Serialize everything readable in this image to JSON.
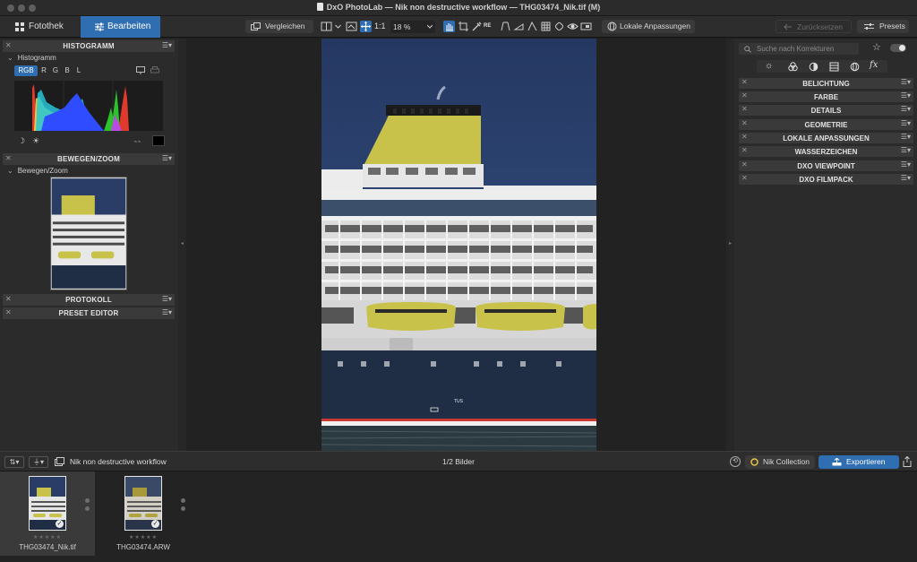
{
  "window": {
    "title": "DxO PhotoLab — Nik non destructive workflow — THG03474_Nik.tif (M)"
  },
  "toolbar": {
    "tab_library": "Fotothek",
    "tab_edit": "Bearbeiten",
    "compare_label": "Vergleichen",
    "one_to_one": "1:1",
    "zoom_value": "18 %",
    "local_adjustments": "Lokale Anpassungen",
    "reset_label": "Zurücksetzen",
    "presets_label": "Presets"
  },
  "left_panel": {
    "histogram_header": "HISTOGRAMM",
    "histogram_sub": "Histogramm",
    "channels": [
      "RGB",
      "R",
      "G",
      "B",
      "L"
    ],
    "move_zoom_header": "BEWEGEN/ZOOM",
    "move_zoom_sub": "Bewegen/Zoom",
    "history_header": "PROTOKOLL",
    "preset_editor_header": "PRESET EDITOR"
  },
  "right_panel": {
    "search_placeholder": "Suche nach Korrekturen",
    "sections": [
      "BELICHTUNG",
      "FARBE",
      "DETAILS",
      "GEOMETRIE",
      "LOKALE ANPASSUNGEN",
      "WASSERZEICHEN",
      "DXO VIEWPOINT",
      "DXO FILMPACK"
    ],
    "fx_label": "fx"
  },
  "filmbar": {
    "project_name": "Nik non destructive workflow",
    "image_count": "1/2 Bilder",
    "nik_label": "Nik Collection",
    "export_label": "Exportieren"
  },
  "filmstrip": {
    "items": [
      {
        "filename": "THG03474_Nik.tif",
        "stars": "★★★★★",
        "selected": true
      },
      {
        "filename": "THG03474.ARW",
        "stars": "★★★★★",
        "selected": false
      }
    ]
  },
  "photo": {
    "ship_text": "TUS"
  },
  "colors": {
    "accent": "#2f6eb0",
    "panel_bg": "#2b2b2b",
    "header_bg": "#3a3a3a",
    "funnel_yellow": "#c8c24a",
    "hull_navy": "#1f2d45",
    "sky": "#2a3d66"
  }
}
